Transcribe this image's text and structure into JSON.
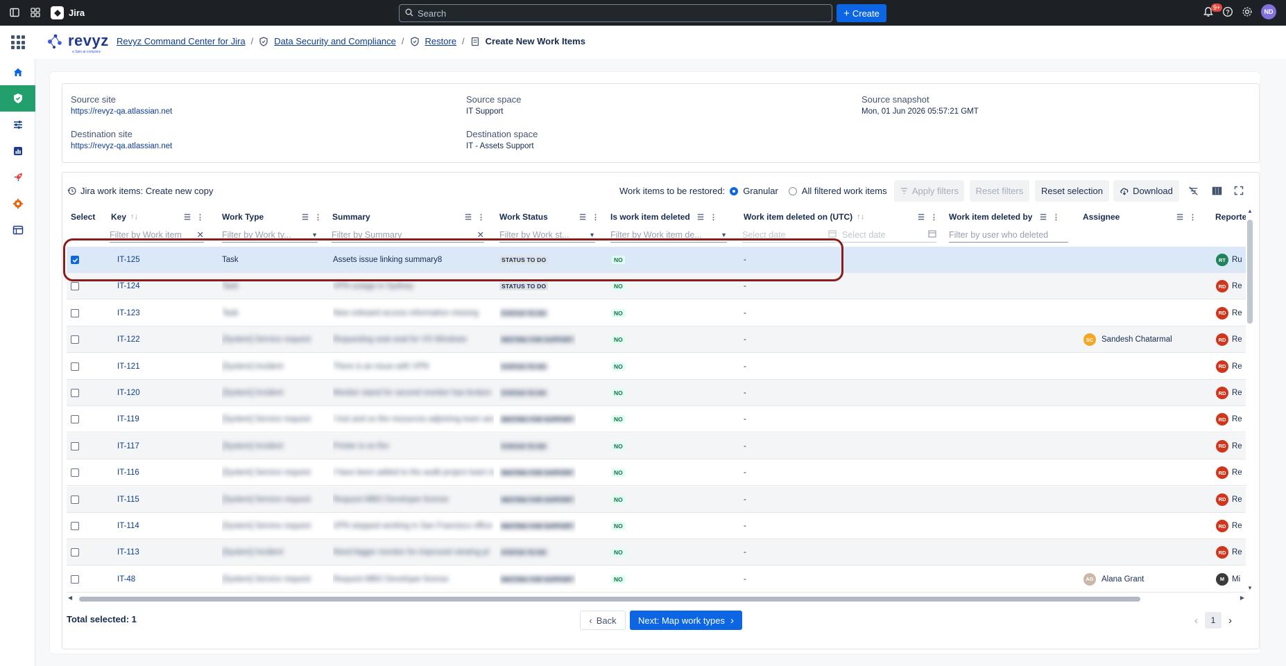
{
  "topbar": {
    "app_name": "Jira",
    "search_placeholder": "Search",
    "create_label": "Create",
    "notifications_count": "9+",
    "avatar_initials": "ND"
  },
  "header": {
    "logo_text": "revyz",
    "logo_sub": "a Spin.ai company",
    "breadcrumbs": [
      "Revyz Command Center for Jira",
      "Data Security and Compliance",
      "Restore"
    ],
    "current": "Create New Work Items"
  },
  "info": {
    "source_site_label": "Source site",
    "source_site": "https://revyz-qa.atlassian.net",
    "source_space_label": "Source space",
    "source_space": "IT Support",
    "source_snapshot_label": "Source snapshot",
    "source_snapshot": "Mon, 01 Jun 2026 05:57:21 GMT",
    "dest_site_label": "Destination site",
    "dest_site": "https://revyz-qa.atlassian.net",
    "dest_space_label": "Destination space",
    "dest_space": "IT - Assets Support"
  },
  "toolbar": {
    "title": "Jira work items: Create new copy",
    "restore_label": "Work items to be restored:",
    "opt_granular": "Granular",
    "opt_all": "All filtered work items",
    "apply_filters": "Apply filters",
    "reset_filters": "Reset filters",
    "reset_selection": "Reset selection",
    "download": "Download"
  },
  "columns": {
    "select": "Select",
    "key": "Key",
    "work_type": "Work Type",
    "summary": "Summary",
    "work_status": "Work Status",
    "is_deleted": "Is work item deleted",
    "deleted_on": "Work item deleted on (UTC)",
    "deleted_by": "Work item deleted by",
    "assignee": "Assignee",
    "reporter": "Reporte"
  },
  "filters": {
    "key": "Filter by Work item",
    "work_type": "Filter by Work ty...",
    "summary": "Filter by Summary",
    "work_status": "Filter by Work st...",
    "is_deleted": "Filter by Work item de...",
    "date_from": "Select date",
    "date_to": "Select date",
    "deleted_by": "Filter by user who deleted"
  },
  "rows": [
    {
      "key": "IT-125",
      "type": "Task",
      "summary": "Assets issue linking summary8",
      "status": "STATUS TO DO",
      "deleted": "NO",
      "deleted_on": "-",
      "assignee": "",
      "reporter_initials": "RT",
      "reporter": "Ru",
      "selected": true
    },
    {
      "key": "IT-124",
      "type": "Task",
      "summary": "VPN outage in Sydney",
      "status": "STATUS TO DO",
      "deleted": "NO",
      "deleted_on": "-",
      "assignee": "",
      "reporter_initials": "RD",
      "reporter": "Re",
      "selected": false
    },
    {
      "key": "IT-123",
      "type": "Task",
      "summary": "New onboard access information missing",
      "status": "STATUS TO DO",
      "deleted": "NO",
      "deleted_on": "-",
      "assignee": "",
      "reporter_initials": "RD",
      "reporter": "Re",
      "selected": false
    },
    {
      "key": "IT-122",
      "type": "[System] Service request",
      "summary": "Requesting seat seat for VS Windows",
      "status": "WAITING FOR SUPPORT",
      "deleted": "NO",
      "deleted_on": "-",
      "assignee": "Sandesh Chatarmal",
      "assignee_initials": "SC",
      "reporter_initials": "RD",
      "reporter": "Re",
      "selected": false
    },
    {
      "key": "IT-121",
      "type": "[System] Incident",
      "summary": "There is an issue with VPN",
      "status": "STATUS TO DO",
      "deleted": "NO",
      "deleted_on": "-",
      "assignee": "",
      "reporter_initials": "RD",
      "reporter": "Re",
      "selected": false
    },
    {
      "key": "IT-120",
      "type": "[System] Incident",
      "summary": "Monitor stand for second monitor has broken",
      "status": "STATUS TO DO",
      "deleted": "NO",
      "deleted_on": "-",
      "assignee": "",
      "reporter_initials": "RD",
      "reporter": "Re",
      "selected": false
    },
    {
      "key": "IT-119",
      "type": "[System] Service request",
      "summary": "I lost and so the resources adjoining team are",
      "status": "WAITING FOR SUPPORT",
      "deleted": "NO",
      "deleted_on": "-",
      "assignee": "",
      "reporter_initials": "RD",
      "reporter": "Re",
      "selected": false
    },
    {
      "key": "IT-117",
      "type": "[System] Incident",
      "summary": "Printer is on fire",
      "status": "STATUS TO DO",
      "deleted": "NO",
      "deleted_on": "-",
      "assignee": "",
      "reporter_initials": "RD",
      "reporter": "Re",
      "selected": false
    },
    {
      "key": "IT-116",
      "type": "[System] Service request",
      "summary": "I have been added to the audit project team in",
      "status": "WAITING FOR SUPPORT",
      "deleted": "NO",
      "deleted_on": "-",
      "assignee": "",
      "reporter_initials": "RD",
      "reporter": "Re",
      "selected": false
    },
    {
      "key": "IT-115",
      "type": "[System] Service request",
      "summary": "Request MBO Developer license",
      "status": "WAITING FOR SUPPORT",
      "deleted": "NO",
      "deleted_on": "-",
      "assignee": "",
      "reporter_initials": "RD",
      "reporter": "Re",
      "selected": false
    },
    {
      "key": "IT-114",
      "type": "[System] Service request",
      "summary": "VPN stopped working in San Francisco office",
      "status": "WAITING FOR SUPPORT",
      "deleted": "NO",
      "deleted_on": "-",
      "assignee": "",
      "reporter_initials": "RD",
      "reporter": "Re",
      "selected": false
    },
    {
      "key": "IT-113",
      "type": "[System] Incident",
      "summary": "Need bigger monitor for improved viewing pl",
      "status": "STATUS TO DO",
      "deleted": "NO",
      "deleted_on": "-",
      "assignee": "",
      "reporter_initials": "RD",
      "reporter": "Re",
      "selected": false
    },
    {
      "key": "IT-48",
      "type": "[System] Service request",
      "summary": "Request MBO Developer license",
      "status": "WAITING FOR SUPPORT",
      "deleted": "NO",
      "deleted_on": "-",
      "assignee": "Alana Grant",
      "assignee_initials": "AG",
      "reporter_initials": "M",
      "reporter": "Mi",
      "selected": false
    }
  ],
  "footer": {
    "total_selected": "Total selected: 1",
    "back": "Back",
    "next": "Next: Map work types",
    "page": "1"
  },
  "colors": {
    "accent": "#0c66e4",
    "sidebar_active": "#22a06b",
    "highlight": "#8b1c1c",
    "reporter_avatar": "#d1361c",
    "reporter_avatar_ru": "#1f845a",
    "assignee_avatar_sc": "#f5a623"
  }
}
